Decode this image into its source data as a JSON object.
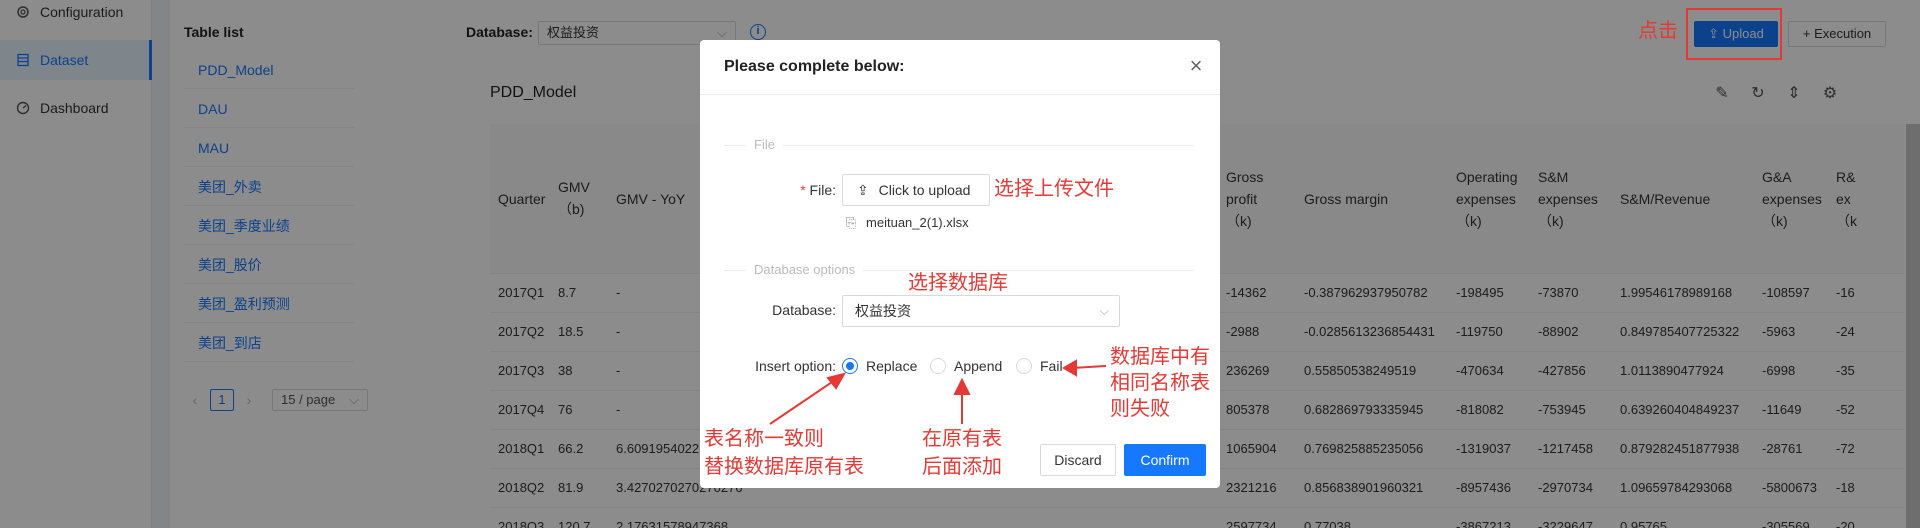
{
  "nav": {
    "items": [
      {
        "label": "Configuration",
        "icon": "gear-icon"
      },
      {
        "label": "Dataset",
        "icon": "table-icon",
        "active": true
      },
      {
        "label": "Dashboard",
        "icon": "dashboard-icon"
      }
    ]
  },
  "table_list": {
    "title": "Table list",
    "items": [
      "PDD_Model",
      "DAU",
      "MAU",
      "美团_外卖",
      "美团_季度业绩",
      "美团_股价",
      "美团_盈利预测",
      "美团_到店"
    ],
    "page": "1",
    "page_size": "15 / page"
  },
  "toolbar": {
    "database_label": "Database:",
    "database_value": "权益投资",
    "upload_label": "Upload",
    "execution_label": "Execution"
  },
  "main": {
    "model_title": "PDD_Model",
    "headers": {
      "quarter": "Quarter",
      "gmv": "GMV",
      "gmv_unit": "（b)",
      "gmv_yoy": "GMV - YoY",
      "gross_profit": "Gross",
      "gross_profit2": "profit",
      "gross_profit_unit": "（k)",
      "gross_margin": "Gross margin",
      "opex": "Operating",
      "opex2": "expenses",
      "opex_unit": "（k)",
      "sm": "S&M",
      "sm2": "expenses",
      "sm_unit": "（k)",
      "sm_rev": "S&M/Revenue",
      "ga": "G&A",
      "ga2": "expenses",
      "ga_unit": "（k)",
      "rd": "R&",
      "rd2": "ex",
      "rd_unit": "（k"
    },
    "rows": [
      {
        "q": "2017Q1",
        "gmv": "8.7",
        "yoy": "-",
        "gp": "-14362",
        "gm": "-0.387962937950782",
        "op": "-198495",
        "sm": "-73870",
        "smr": "1.99546178989168",
        "ga": "-108597",
        "rd": "-16"
      },
      {
        "q": "2017Q2",
        "gmv": "18.5",
        "yoy": "-",
        "gp": "-2988",
        "gm": "-0.0285613236854431",
        "op": "-119750",
        "sm": "-88902",
        "smr": "0.849785407725322",
        "ga": "-5963",
        "rd": "-24"
      },
      {
        "q": "2017Q3",
        "gmv": "38",
        "yoy": "-",
        "gp": "236269",
        "gm": "0.55850538249519",
        "op": "-470634",
        "sm": "-427856",
        "smr": "1.0113890477924",
        "ga": "-6998",
        "rd": "-35"
      },
      {
        "q": "2017Q4",
        "gmv": "76",
        "yoy": "-",
        "gp": "805378",
        "gm": "0.682869793335945",
        "op": "-818082",
        "sm": "-753945",
        "smr": "0.639260404849237",
        "ga": "-11649",
        "rd": "-52"
      },
      {
        "q": "2018Q1",
        "gmv": "66.2",
        "yoy": "6.6091954022",
        "gp": "1065904",
        "gm": "0.769825885235056",
        "op": "-1319037",
        "sm": "-1217458",
        "smr": "0.879282451877938",
        "ga": "-28761",
        "rd": "-72"
      },
      {
        "q": "2018Q2",
        "gmv": "81.9",
        "yoy": "3.4270270270270276",
        "gp": "2321216",
        "gm": "0.856838901960321",
        "op": "-8957436",
        "sm": "-2970734",
        "smr": "1.09659784293068",
        "ga": "-5800673",
        "rd": "-18"
      },
      {
        "q": "2018Q3",
        "gmv": "120.7",
        "yoy": "2.17631578947368",
        "gp": "2597734",
        "gm": "0.77038...",
        "op": "-3867213",
        "sm": "-3229647",
        "smr": "0.95765",
        "ga": "-305569",
        "rd": "-20"
      }
    ]
  },
  "modal": {
    "title": "Please complete below:",
    "file_section": "File",
    "file_label": "File:",
    "required_mark": "*",
    "upload_button": "Click to upload",
    "uploaded_file": "meituan_2(1).xlsx",
    "db_section": "Database options",
    "database_label": "Database:",
    "database_value": "权益投资",
    "insert_label": "Insert option:",
    "options": [
      "Replace",
      "Append",
      "Fail"
    ],
    "selected_option": "Replace",
    "discard": "Discard",
    "confirm": "Confirm"
  },
  "annotations": {
    "click": "点击",
    "select_file": "选择上传文件",
    "select_db": "选择数据库",
    "fail_line1": "数据库中有",
    "fail_line2": "相同名称表",
    "fail_line3": "则失败",
    "replace_line1": "表名称一致则",
    "replace_line2": "替换数据库原有表",
    "append_line1": "在原有表",
    "append_line2": "后面添加"
  },
  "colors": {
    "accent": "#1677ff",
    "annotation": "#e53935"
  }
}
